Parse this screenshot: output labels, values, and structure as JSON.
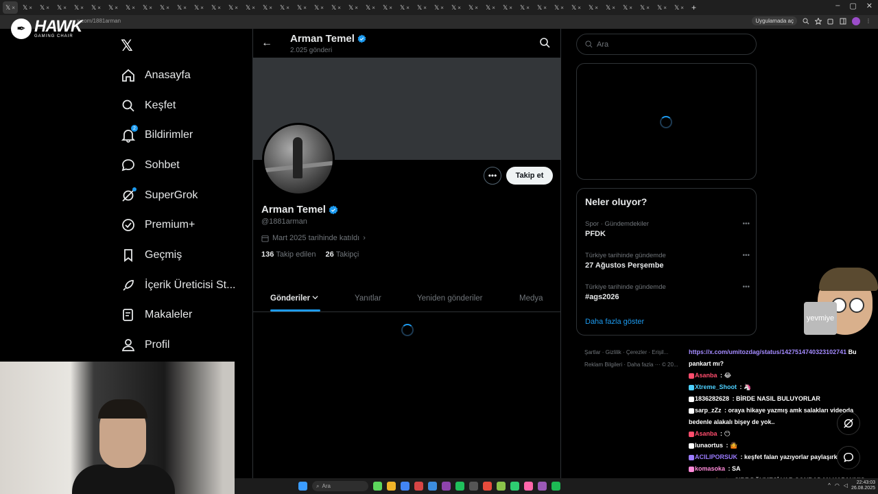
{
  "browser": {
    "address": "x.com/1881arman",
    "app_chip": "Uygulamada aç",
    "tab_glyph": "𝕏",
    "tab_close": "×",
    "new_tab": "+",
    "win_min": "–",
    "win_max": "▢",
    "win_close": "✕"
  },
  "overlay_brand": {
    "title": "HAWK",
    "subtitle": "GAMING CHAIR"
  },
  "sidebar": {
    "logo": "𝕏",
    "items": [
      {
        "label": "Anasayfa",
        "icon": "home-icon"
      },
      {
        "label": "Keşfet",
        "icon": "search-icon"
      },
      {
        "label": "Bildirimler",
        "icon": "bell-icon",
        "badge": "2"
      },
      {
        "label": "Sohbet",
        "icon": "chat-icon"
      },
      {
        "label": "SuperGrok",
        "icon": "grok-icon"
      },
      {
        "label": "Premium+",
        "icon": "premium-icon"
      },
      {
        "label": "Geçmiş",
        "icon": "bookmark-icon"
      },
      {
        "label": "İçerik Üreticisi St...",
        "icon": "rocket-icon"
      },
      {
        "label": "Makaleler",
        "icon": "article-icon"
      },
      {
        "label": "Profil",
        "icon": "person-icon"
      }
    ]
  },
  "profile": {
    "back": "←",
    "header_name": "Arman Temel",
    "post_count": "2.025 gönderi",
    "name": "Arman Temel",
    "handle": "@1881arman",
    "joined": "Mart 2025 tarihinde katıldı",
    "joined_chevron": "›",
    "following_count": "136",
    "following_label": "Takip edilen",
    "followers_count": "26",
    "followers_label": "Takipçi",
    "more": "•••",
    "follow_label": "Takip et",
    "tabs": [
      {
        "label": "Gönderiler",
        "active": true
      },
      {
        "label": "Yanıtlar"
      },
      {
        "label": "Yeniden gönderiler"
      },
      {
        "label": "Medya"
      }
    ]
  },
  "right": {
    "search_placeholder": "Ara",
    "trends_title": "Neler oluyor?",
    "trends": [
      {
        "meta": "Spor · Gündemdekiler",
        "name": "PFDK"
      },
      {
        "meta": "Türkiye tarihinde gündemde",
        "name": "27 Ağustos Perşembe"
      },
      {
        "meta": "Türkiye tarihinde gündemde",
        "name": "#ags2026"
      }
    ],
    "trend_more": "•••",
    "show_more": "Daha fazla göster",
    "footer": {
      "terms": "Şartlar",
      "privacy": "Gizlilik",
      "cookies": "Çerezler",
      "access": "Erişil...",
      "ads": "Reklam Bilgileri",
      "more": "Daha fazla ···",
      "copyright": "© 20..."
    }
  },
  "mascot": {
    "label": "yevmiye"
  },
  "chat": [
    {
      "user": "",
      "text": "https://x.com/umitozdag/status/1427514740323102741 Bu pankart mı?",
      "link": "https://x.com/umitozdag/status/1427514740323102741",
      "rest": " Bu pankart mı?",
      "color": "#ffffff"
    },
    {
      "user": "Asanba",
      "text": " : 😂",
      "color": "#ff4d6d"
    },
    {
      "user": "Xtreme_Shoot",
      "text": " : 🦄",
      "color": "#4dd0ff"
    },
    {
      "user": "1836282628",
      "text": " : BİRDE NASIL BULUYORLAR",
      "color": "#ffffff"
    },
    {
      "user": "sarp_zZz",
      "text": " : oraya hikaye yazmış amk salakları videoda bedenle alakalı bişey de yok..",
      "color": "#ffffff"
    },
    {
      "user": "Asanba",
      "text": " : 😶",
      "color": "#ff4d6d"
    },
    {
      "user": "lunaortus",
      "text": " : 🤷",
      "color": "#ffffff"
    },
    {
      "user": "ACILIPORSUK",
      "text": " : keşfet falan yazıyorlar paylaşırken",
      "color": "#9b7bff"
    },
    {
      "user": "komasoka",
      "text": " : SA",
      "color": "#ff8ad8"
    },
    {
      "user": "warwarkort",
      "text": " : SIRF DÖVMESİ VAR SONRADAN KAPANMIŞ DİYE ETKİLEŞİM VERİCEJ YA",
      "color": "#ffb347"
    }
  ],
  "taskbar": {
    "search": "Ara",
    "time": "22:43:03",
    "date": "26.08.2025"
  },
  "colors": {
    "accent": "#1d9bf0",
    "background": "#000000",
    "border": "#2f3336",
    "muted": "#71767b"
  }
}
